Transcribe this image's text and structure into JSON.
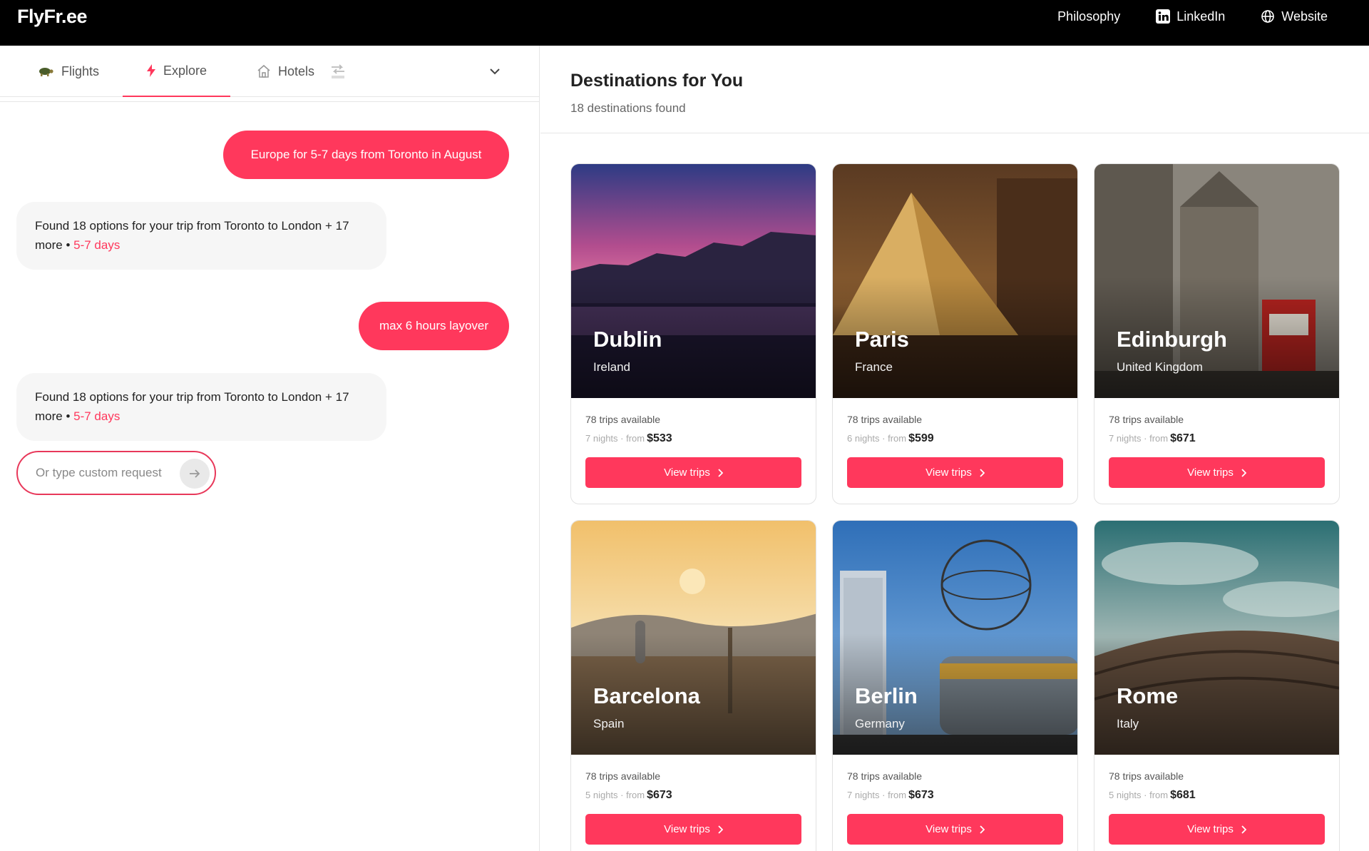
{
  "app": {
    "logo": "FlyFr.ee",
    "nav": [
      {
        "label": "Philosophy"
      },
      {
        "label": "LinkedIn",
        "icon": "linkedin-icon"
      },
      {
        "label": "Website",
        "icon": "globe-icon"
      }
    ]
  },
  "tabs": {
    "flights": "Flights",
    "explore": "Explore",
    "hotels": "Hotels",
    "active": "Explore"
  },
  "chat": {
    "user_message_1": "Europe for 5-7 days from Toronto in August",
    "bot_reply_1": "Found 18 options for your trip from Toronto to London + 17 more",
    "bot_reply_1_separator": " • ",
    "bot_reply_1_accent": "5-7 days",
    "user_message_2": "max 6 hours layover",
    "bot_reply_2": "Found 18 options for your trip from Toronto to London + 17 more",
    "bot_reply_2_separator": " • ",
    "bot_reply_2_accent": "5-7 days",
    "input_placeholder": "Or type custom request",
    "input_value": ""
  },
  "destinations": {
    "title": "Destinations for You",
    "count_text": "18 destinations found",
    "button_label": "View trips",
    "from_label": "from",
    "cards": [
      {
        "city": "Dublin",
        "country": "Ireland",
        "trips": "78 trips available",
        "nights": "7 nights",
        "price": "$533"
      },
      {
        "city": "Paris",
        "country": "France",
        "trips": "78 trips available",
        "nights": "6 nights",
        "price": "$599"
      },
      {
        "city": "Edinburgh",
        "country": "United Kingdom",
        "trips": "78 trips available",
        "nights": "7 nights",
        "price": "$671"
      },
      {
        "city": "Barcelona",
        "country": "Spain",
        "trips": "78 trips available",
        "nights": "5 nights",
        "price": "$673"
      },
      {
        "city": "Berlin",
        "country": "Germany",
        "trips": "78 trips available",
        "nights": "7 nights",
        "price": "$673"
      },
      {
        "city": "Rome",
        "country": "Italy",
        "trips": "78 trips available",
        "nights": "5 nights",
        "price": "$681"
      }
    ]
  },
  "colors": {
    "accent": "#ff385c",
    "topbar": "#000000",
    "bot_bubble": "#f6f6f6"
  }
}
